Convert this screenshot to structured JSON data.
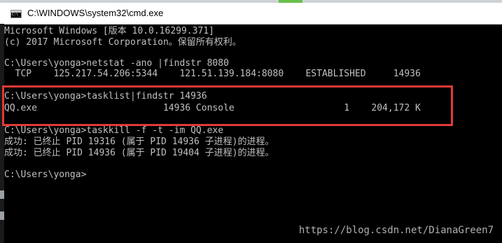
{
  "window": {
    "title": "C:\\WINDOWS\\system32\\cmd.exe"
  },
  "console": {
    "lines": [
      "Microsoft Windows [版本 10.0.16299.371]",
      "(c) 2017 Microsoft Corporation。保留所有权利。",
      "",
      "C:\\Users\\yonga>netstat -ano |findstr 8080",
      "  TCP    125.217.54.206:5344    121.51.139.184:8080    ESTABLISHED     14936",
      "",
      "C:\\Users\\yonga>tasklist|findstr 14936",
      "QQ.exe                       14936 Console                    1    204,172 K",
      "",
      "C:\\Users\\yonga>taskkill -f -t -im QQ.exe",
      "成功: 已终止 PID 19316 (属于 PID 14936 子进程)的进程。",
      "成功: 已终止 PID 14936 (属于 PID 19404 子进程)的进程。",
      "",
      "C:\\Users\\yonga>"
    ]
  },
  "annotation": {
    "highlight_color": "#e03a36"
  },
  "watermark": "https://blog.csdn.net/DianaGreen7"
}
